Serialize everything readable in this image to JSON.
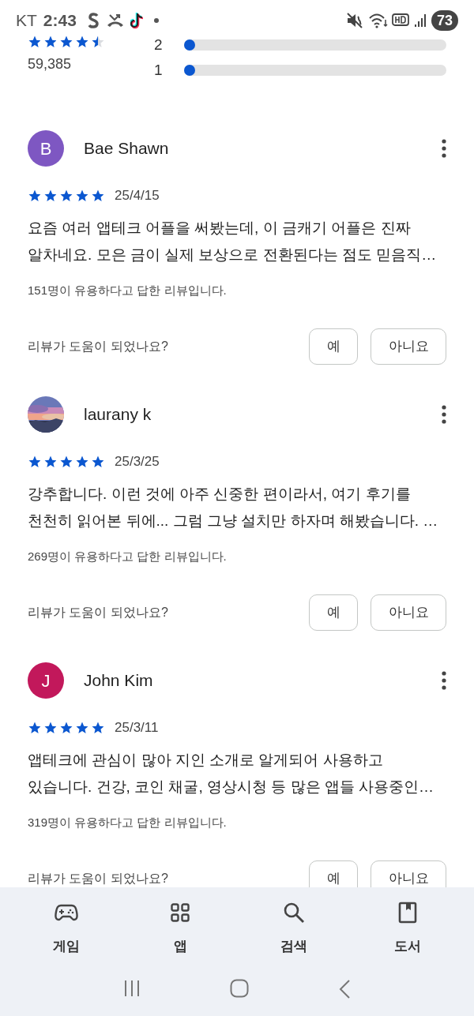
{
  "status_bar": {
    "carrier": "KT",
    "time": "2:43",
    "battery": "73"
  },
  "rating_summary": {
    "stars": 4.5,
    "count": "59,385",
    "bars": [
      {
        "label": "2",
        "level": 0.02
      },
      {
        "label": "1",
        "level": 0.02
      }
    ]
  },
  "reviews": [
    {
      "author": "Bae Shawn",
      "avatar": {
        "kind": "letter",
        "letter": "B",
        "color": "#7e57c2"
      },
      "stars": 5,
      "date": "25/4/15",
      "text": "요즘 여러 앱테크 어플을 써봤는데, 이 금캐기 어플은 진짜 알차네요. 모은 금이 실제 보상으로 전환된다는 점도 믿음직…",
      "helpful_count": "151명이 유용하다고 답한 리뷰입니다.",
      "question": "리뷰가 도움이 되었나요?",
      "buttons": [
        "예",
        "아니요"
      ]
    },
    {
      "author": "laurany k",
      "avatar": {
        "kind": "picture"
      },
      "stars": 5,
      "date": "25/3/25",
      "text": "강추합니다. 이런 것에 아주 신중한 편이라서, 여기 후기를 천천히 읽어본 뒤에... 그럼 그냥 설치만 하자며 해봤습니다. …",
      "helpful_count": "269명이 유용하다고 답한 리뷰입니다.",
      "question": "리뷰가 도움이 되었나요?",
      "buttons": [
        "예",
        "아니요"
      ]
    },
    {
      "author": "John Kim",
      "avatar": {
        "kind": "letter",
        "letter": "J",
        "color": "#c2185b"
      },
      "stars": 5,
      "date": "25/3/11",
      "text": "앱테크에 관심이 많아 지인 소개로 알게되어 사용하고 있습니다. 건강, 코인 채굴, 영상시청 등 많은 앱들 사용중인…",
      "helpful_count": "319명이 유용하다고 답한 리뷰입니다.",
      "question": "리뷰가 도움이 되었나요?",
      "buttons": [
        "예",
        "아니요"
      ]
    }
  ],
  "bottom_nav": [
    {
      "kind": "games",
      "label": "게임"
    },
    {
      "kind": "apps",
      "label": "앱"
    },
    {
      "kind": "search",
      "label": "검색"
    },
    {
      "kind": "books",
      "label": "도서"
    }
  ]
}
